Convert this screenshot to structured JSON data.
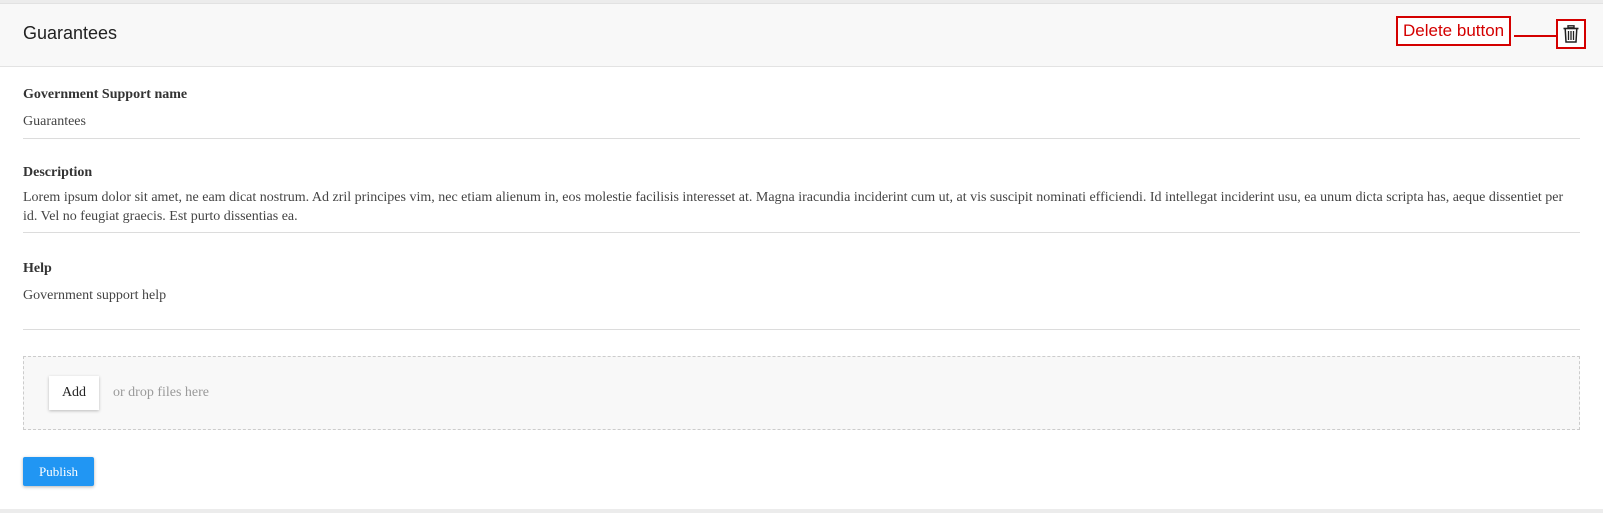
{
  "header": {
    "title": "Guarantees",
    "annotation": "Delete button",
    "delete_icon": "trash-icon",
    "annotation_color": "#d40000"
  },
  "fields": {
    "name": {
      "label": "Government Support name",
      "value": "Guarantees"
    },
    "description": {
      "label": "Description",
      "value": "Lorem ipsum dolor sit amet, ne eam dicat nostrum. Ad zril principes vim, nec etiam alienum in, eos molestie facilisis interesset at. Magna iracundia inciderint cum ut, at vis suscipit nominati efficiendi. Id intellegat inciderint usu, ea unum dicta scripta has, aeque dissentiet per id. Vel no feugiat graecis. Est purto dissentias ea."
    },
    "help": {
      "label": "Help",
      "value": "Government support help"
    }
  },
  "upload": {
    "add_label": "Add",
    "hint": "or drop files here"
  },
  "actions": {
    "publish_label": "Publish",
    "publish_color": "#2196f3"
  }
}
